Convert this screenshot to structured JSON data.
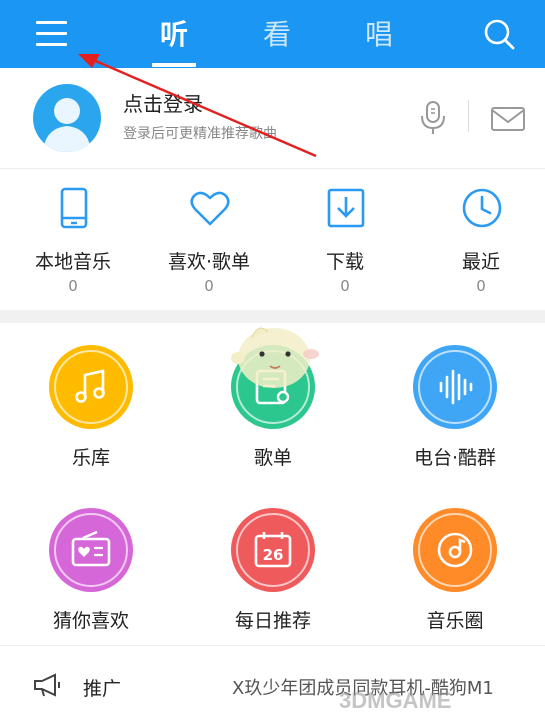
{
  "header": {
    "tabs": [
      {
        "label": "听",
        "active": true
      },
      {
        "label": "看",
        "active": false
      },
      {
        "label": "唱",
        "active": false
      }
    ],
    "icons": {
      "menu": "menu-icon",
      "search": "search-icon"
    }
  },
  "profile": {
    "title": "点击登录",
    "subtitle": "登录后可更精准推荐歌曲",
    "icons": {
      "avatar": "avatar",
      "mic": "microphone-icon",
      "mail": "mail-icon"
    }
  },
  "stats": [
    {
      "label": "本地音乐",
      "count": "0",
      "icon": "phone-icon"
    },
    {
      "label": "喜欢·歌单",
      "count": "0",
      "icon": "heart-icon"
    },
    {
      "label": "下载",
      "count": "0",
      "icon": "download-icon"
    },
    {
      "label": "最近",
      "count": "0",
      "icon": "clock-icon"
    }
  ],
  "grid": [
    {
      "label": "乐库",
      "icon": "music-note-icon",
      "color": "#ffbb00"
    },
    {
      "label": "歌单",
      "icon": "playlist-icon",
      "color": "#2cc68f"
    },
    {
      "label": "电台·酷群",
      "icon": "sound-wave-icon",
      "color": "#3fa6f5"
    },
    {
      "label": "猜你喜欢",
      "icon": "radio-heart-icon",
      "color": "#d667d9"
    },
    {
      "label": "每日推荐",
      "icon": "calendar-icon",
      "color": "#ef5a5c",
      "badge": "26"
    },
    {
      "label": "音乐圈",
      "icon": "disc-icon",
      "color": "#ff8a28"
    }
  ],
  "promo": {
    "label": "推广",
    "text": "X玖少年团成员同款耳机-酷狗M1",
    "icon": "megaphone-icon"
  },
  "watermark": "3DMGAME",
  "colors": {
    "accent": "#1b96f2",
    "arrow": "#e32020"
  }
}
